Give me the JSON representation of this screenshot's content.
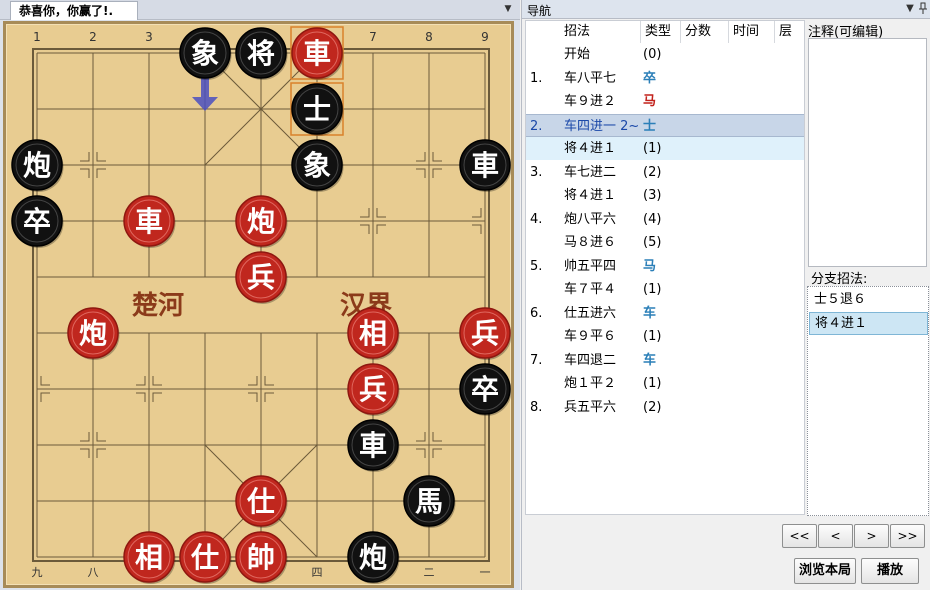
{
  "left_panel": {
    "tab_title": "恭喜你，你赢了!.",
    "dropdown_icon": "▼"
  },
  "board": {
    "top_file_labels": [
      "1",
      "2",
      "3",
      "4",
      "5",
      "6",
      "7",
      "8",
      "9"
    ],
    "bottom_file_labels": [
      "九",
      "八",
      "",
      "",
      "",
      "四",
      "",
      "二",
      "一"
    ],
    "river_left": "楚河",
    "river_right": "汉界",
    "pieces": [
      {
        "char": "象",
        "side": "black",
        "file": 3,
        "rank": 0
      },
      {
        "char": "将",
        "side": "black",
        "file": 4,
        "rank": 0
      },
      {
        "char": "車",
        "side": "red",
        "file": 5,
        "rank": 0
      },
      {
        "char": "士",
        "side": "black",
        "file": 5,
        "rank": 1
      },
      {
        "char": "炮",
        "side": "black",
        "file": 0,
        "rank": 2
      },
      {
        "char": "象",
        "side": "black",
        "file": 5,
        "rank": 2
      },
      {
        "char": "車",
        "side": "black",
        "file": 8,
        "rank": 2
      },
      {
        "char": "卒",
        "side": "black",
        "file": 0,
        "rank": 3
      },
      {
        "char": "車",
        "side": "red",
        "file": 2,
        "rank": 3
      },
      {
        "char": "炮",
        "side": "red",
        "file": 4,
        "rank": 3
      },
      {
        "char": "兵",
        "side": "red",
        "file": 4,
        "rank": 4
      },
      {
        "char": "炮",
        "side": "red",
        "file": 1,
        "rank": 5
      },
      {
        "char": "相",
        "side": "red",
        "file": 6,
        "rank": 5
      },
      {
        "char": "兵",
        "side": "red",
        "file": 8,
        "rank": 5
      },
      {
        "char": "兵",
        "side": "red",
        "file": 6,
        "rank": 6
      },
      {
        "char": "卒",
        "side": "black",
        "file": 8,
        "rank": 6
      },
      {
        "char": "車",
        "side": "black",
        "file": 6,
        "rank": 7
      },
      {
        "char": "仕",
        "side": "red",
        "file": 4,
        "rank": 8
      },
      {
        "char": "馬",
        "side": "black",
        "file": 7,
        "rank": 8
      },
      {
        "char": "相",
        "side": "red",
        "file": 2,
        "rank": 9
      },
      {
        "char": "仕",
        "side": "red",
        "file": 3,
        "rank": 9
      },
      {
        "char": "帥",
        "side": "red",
        "file": 4,
        "rank": 9
      },
      {
        "char": "炮",
        "side": "black",
        "file": 6,
        "rank": 9
      }
    ],
    "last_move_from": {
      "file": 5,
      "rank": 1
    },
    "last_move_to": {
      "file": 5,
      "rank": 0
    },
    "hint_arrow": {
      "file": 3,
      "rank": 1
    },
    "colors": {
      "board": "#e8cc91",
      "line": "#6b5a3a",
      "red_piece": "#c0271e",
      "black_piece": "#111111",
      "highlight": "#d9822b",
      "arrow": "#4a4fc0",
      "river_text": "#8b3a1a"
    }
  },
  "nav": {
    "title": "导航",
    "pin_icon": "▼",
    "pushpin_icon": "📌",
    "columns": [
      "招法",
      "类型",
      "分数",
      "时间",
      "层"
    ],
    "moves": [
      {
        "num": "",
        "move": "开始",
        "type": "(0)",
        "style": "plain"
      },
      {
        "num": "1.",
        "move": "车八平七",
        "type": "卒",
        "style": "blue"
      },
      {
        "num": "",
        "move": "车９进２",
        "type": "马",
        "style": "red"
      },
      {
        "num": "2.",
        "move": "车四进一 2~",
        "type": "士",
        "style": "blue"
      },
      {
        "num": "",
        "move": "将４进１",
        "type": "(1)",
        "style": "plain"
      },
      {
        "num": "3.",
        "move": "车七进二",
        "type": "(2)",
        "style": "plain"
      },
      {
        "num": "",
        "move": "将４进１",
        "type": "(3)",
        "style": "plain"
      },
      {
        "num": "4.",
        "move": "炮八平六",
        "type": "(4)",
        "style": "plain"
      },
      {
        "num": "",
        "move": "马８进６",
        "type": "(5)",
        "style": "plain"
      },
      {
        "num": "5.",
        "move": "帅五平四",
        "type": "马",
        "style": "blue"
      },
      {
        "num": "",
        "move": "车７平４",
        "type": "(1)",
        "style": "plain"
      },
      {
        "num": "6.",
        "move": "仕五进六",
        "type": "车",
        "style": "blue"
      },
      {
        "num": "",
        "move": "车９平６",
        "type": "(1)",
        "style": "plain"
      },
      {
        "num": "7.",
        "move": "车四退二",
        "type": "车",
        "style": "blue"
      },
      {
        "num": "",
        "move": "炮１平２",
        "type": "(1)",
        "style": "plain"
      },
      {
        "num": "8.",
        "move": "兵五平六",
        "type": "(2)",
        "style": "plain"
      }
    ],
    "selected_index": 3,
    "hover_index": 4,
    "note_label": "注释(可编辑)",
    "branch_label": "分支招法:",
    "branches": [
      "士５退６",
      "将４进１"
    ],
    "selected_branch": 1,
    "buttons": {
      "first": "<<",
      "prev": "<",
      "next": ">",
      "last": ">>",
      "browse": "浏览本局",
      "play": "播放"
    }
  }
}
